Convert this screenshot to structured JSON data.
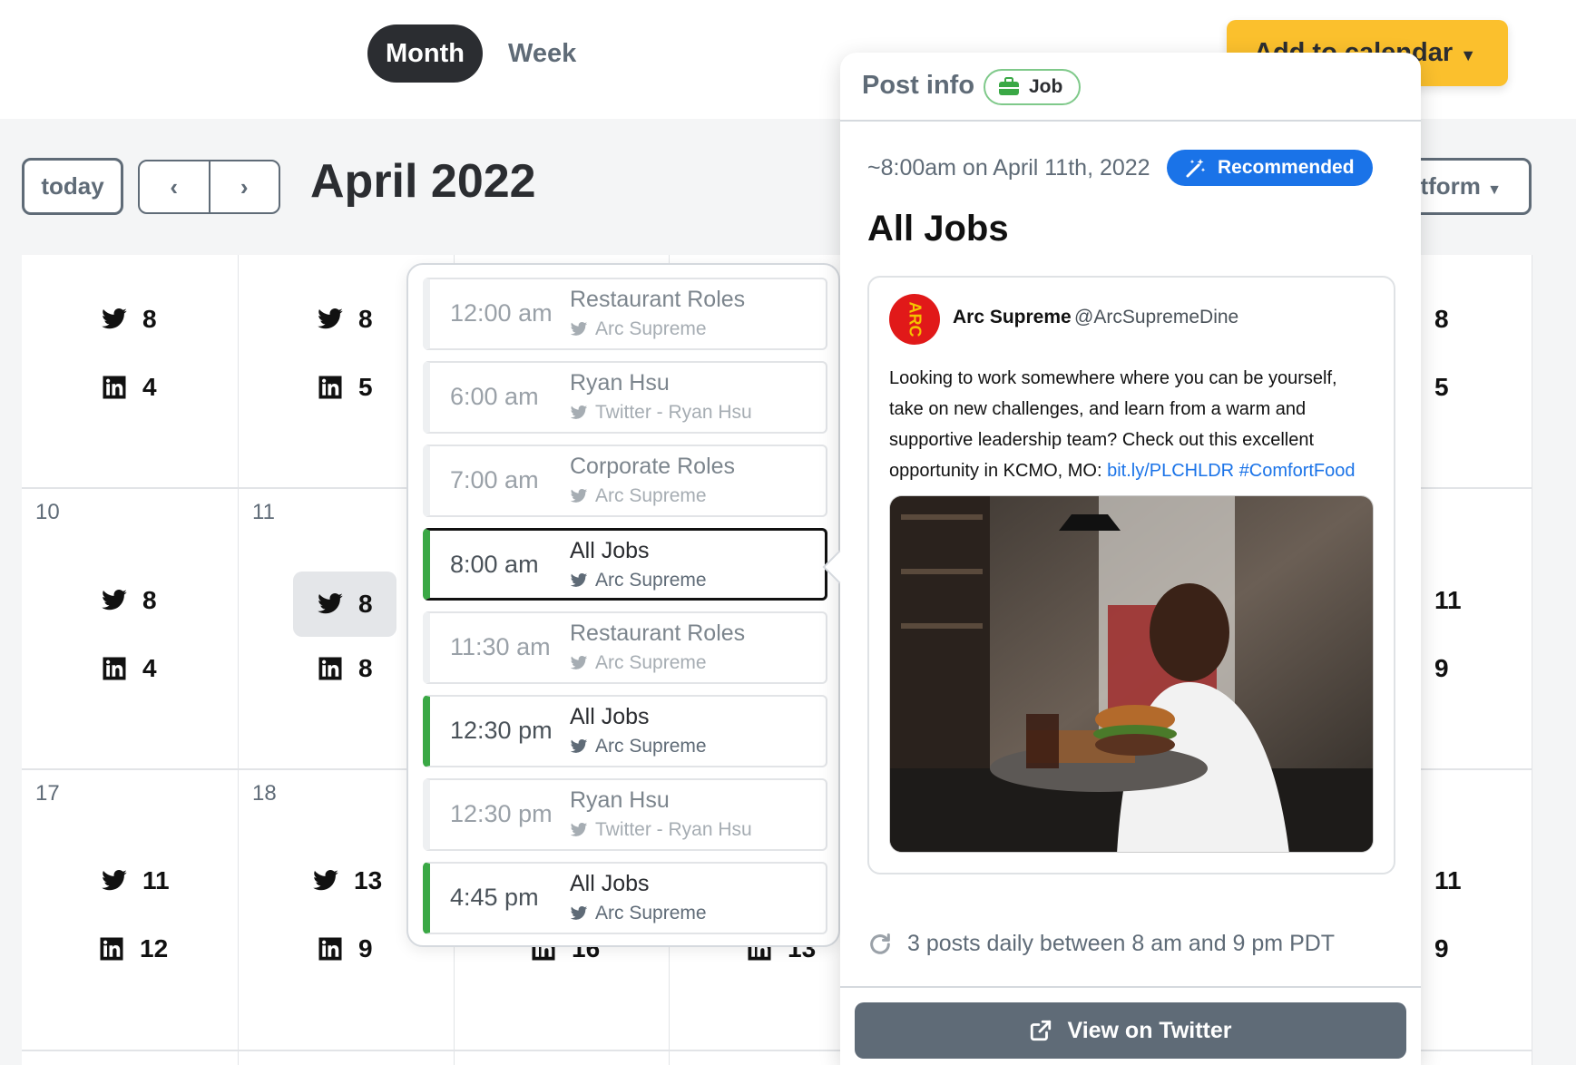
{
  "header": {
    "view_month": "Month",
    "view_week": "Week",
    "add_to_calendar": "Add to calendar"
  },
  "toolbar": {
    "today": "today",
    "month_title": "April 2022",
    "platform": "Platform"
  },
  "calendar": {
    "day_numbers": [
      "10",
      "11",
      "17",
      "18"
    ],
    "weeks": [
      {
        "cells": [
          {
            "twitter": "8",
            "linkedin": "4"
          },
          {
            "twitter": "8",
            "linkedin": "5"
          },
          {
            "twitter": "8",
            "linkedin": "5"
          }
        ]
      },
      {
        "cells": [
          {
            "twitter": "8",
            "linkedin": "4"
          },
          {
            "twitter": "8",
            "linkedin": "8"
          },
          {
            "twitter": "11",
            "linkedin": "9"
          }
        ]
      },
      {
        "cells": [
          {
            "twitter": "11",
            "linkedin": "12"
          },
          {
            "twitter": "13",
            "linkedin": "9"
          },
          {
            "linkedin": "16"
          },
          {
            "linkedin": "13"
          },
          {
            "twitter": "11",
            "linkedin": "9"
          }
        ]
      }
    ]
  },
  "day_events": [
    {
      "time": "12:00 am",
      "name": "Restaurant Roles",
      "source": "Arc Supreme"
    },
    {
      "time": "6:00 am",
      "name": "Ryan Hsu",
      "source": "Twitter - Ryan Hsu"
    },
    {
      "time": "7:00 am",
      "name": "Corporate Roles",
      "source": "Arc Supreme"
    },
    {
      "time": "8:00 am",
      "name": "All Jobs",
      "source": "Arc Supreme"
    },
    {
      "time": "11:30 am",
      "name": "Restaurant Roles",
      "source": "Arc Supreme"
    },
    {
      "time": "12:30 pm",
      "name": "All Jobs",
      "source": "Arc Supreme"
    },
    {
      "time": "12:30 pm",
      "name": "Ryan Hsu",
      "source": "Twitter - Ryan Hsu"
    },
    {
      "time": "4:45 pm",
      "name": "All Jobs",
      "source": "Arc Supreme"
    }
  ],
  "post": {
    "header": "Post info",
    "badge": "Job",
    "when": "~8:00am on April 11th, 2022",
    "recommended": "Recommended",
    "name": "All Jobs",
    "tweet": {
      "avatar_text": "ARC",
      "author": "Arc Supreme",
      "handle": "@ArcSupremeDine",
      "text": "Looking to work somewhere where you can be yourself, take on new challenges, and learn from a warm and supportive leadership team? Check out this excellent opportunity in KCMO, MO: ",
      "link": "bit.ly/PLCHLDR",
      "hashtag": "#ComfortFood"
    },
    "schedule": "3 posts daily between 8 am and 9 pm PDT",
    "view_button": "View on Twitter"
  },
  "colors": {
    "accent_yellow": "#fbc02d",
    "accent_blue": "#1a73e8",
    "event_green": "#3aa845",
    "dark_toggle": "#2b2d31"
  },
  "icons": [
    "twitter-icon",
    "linkedin-icon",
    "briefcase-icon",
    "magic-wand-icon",
    "repeat-icon",
    "external-link-icon",
    "chevron-left-icon",
    "chevron-right-icon",
    "caret-down-icon"
  ]
}
